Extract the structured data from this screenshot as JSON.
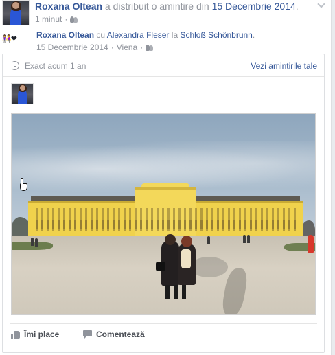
{
  "post": {
    "author": "Roxana Oltean",
    "action_text": "a distribuit o amintire din",
    "date_link": "15 Decembrie 2014",
    "date_suffix": ".",
    "time_ago": "1 minut",
    "separator": " · ",
    "audience_icon": "friends-icon",
    "menu_icon": "chevron-down-icon",
    "emoji_line": "👭❤"
  },
  "memory": {
    "ago": "Exact acum 1 an",
    "see_memories": "Vezi amintirile tale",
    "clock_icon": "clock-icon",
    "inner_author": "Roxana Oltean",
    "with_word": " cu ",
    "tagged_friend": "Alexandra Fleser",
    "at_word": " la ",
    "location": "Schloß Schönbrunn",
    "location_suffix": ".",
    "date": "15 Decembrie 2014",
    "separator": " · ",
    "city": "Viena",
    "separator2": " · "
  },
  "actions": {
    "like_label": "Îmi place",
    "comment_label": "Comentează",
    "like_icon": "like-icon",
    "comment_icon": "comment-icon"
  },
  "colors": {
    "link": "#365899",
    "meta": "#90949c",
    "palace": "#f0d24c"
  }
}
